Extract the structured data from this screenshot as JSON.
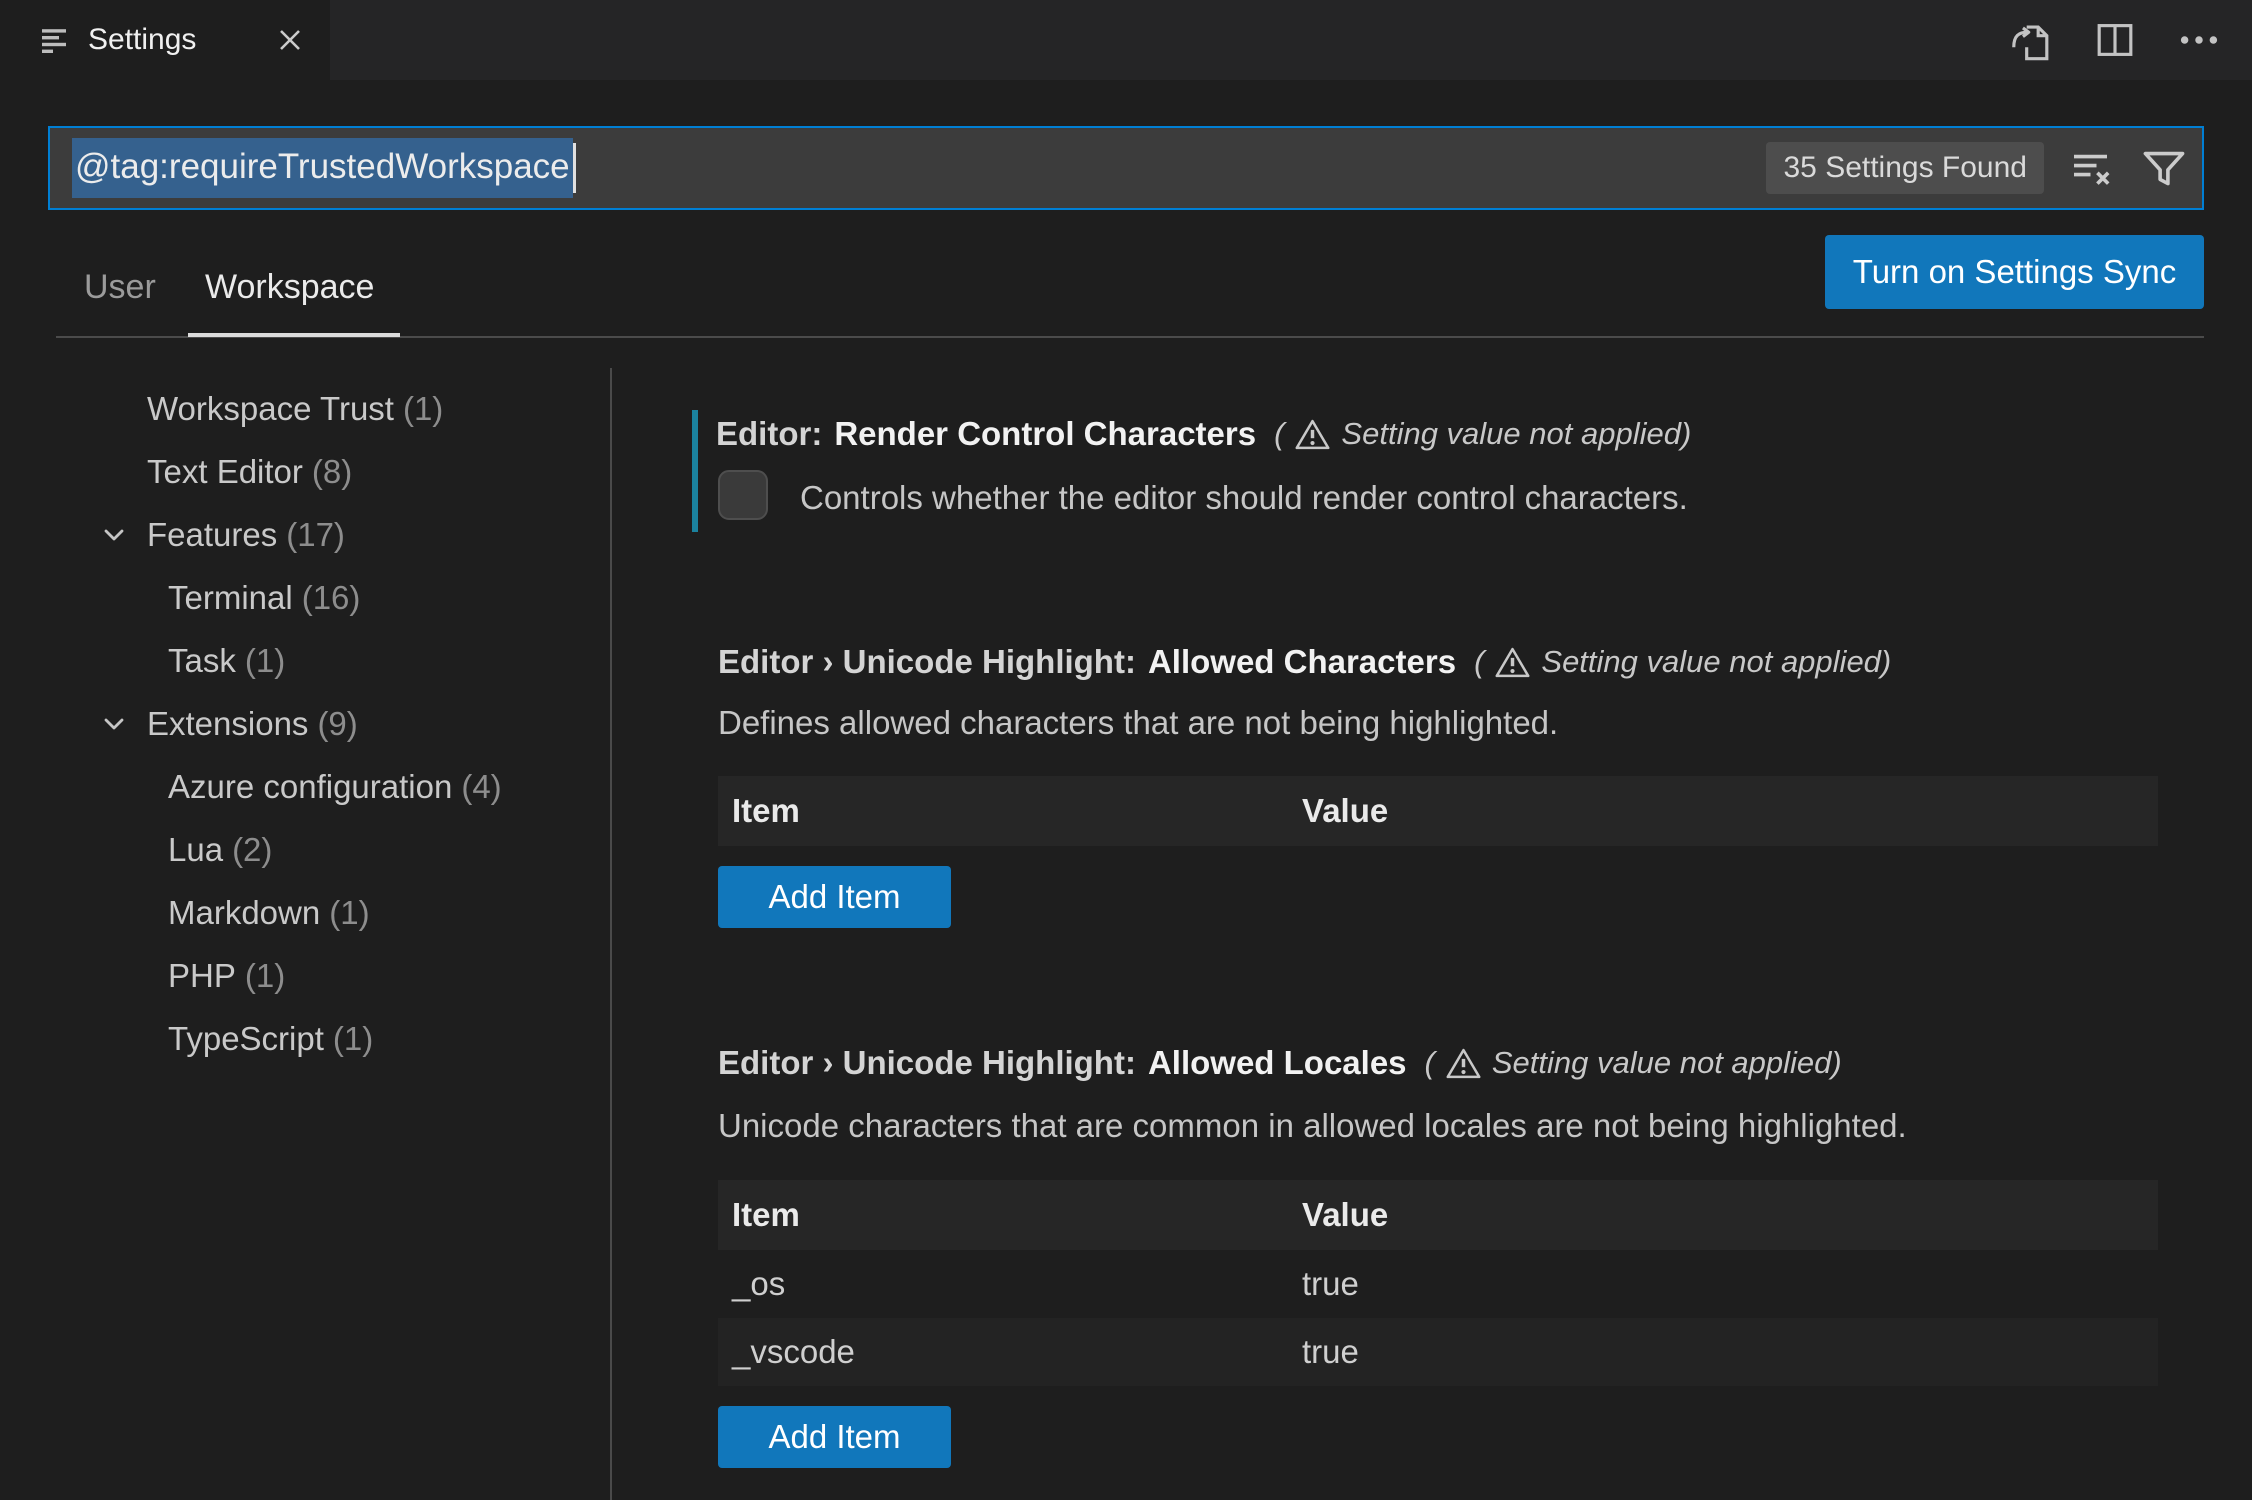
{
  "window": {
    "tab_title": "Settings"
  },
  "editor_actions": {
    "open_settings_json": "open-settings-json",
    "split_editor": "split-editor",
    "more_actions": "more-actions"
  },
  "search": {
    "value": "@tag:requireTrustedWorkspace",
    "results": "35 Settings Found"
  },
  "scope_tabs": {
    "user": "User",
    "workspace": "Workspace"
  },
  "sync_button": {
    "label": "Turn on Settings Sync"
  },
  "toc": [
    {
      "label": "Workspace Trust",
      "count": "(1)"
    },
    {
      "label": "Text Editor",
      "count": "(8)"
    },
    {
      "label": "Features",
      "count": "(17)"
    },
    {
      "label": "Terminal",
      "count": "(16)"
    },
    {
      "label": "Task",
      "count": "(1)"
    },
    {
      "label": "Extensions",
      "count": "(9)"
    },
    {
      "label": "Azure configuration",
      "count": "(4)"
    },
    {
      "label": "Lua",
      "count": "(2)"
    },
    {
      "label": "Markdown",
      "count": "(1)"
    },
    {
      "label": "PHP",
      "count": "(1)"
    },
    {
      "label": "TypeScript",
      "count": "(1)"
    }
  ],
  "settings": [
    {
      "category": "Editor:",
      "name": "Render Control Characters",
      "warn_open": "(",
      "warning": "Setting value not applied)",
      "description": "Controls whether the editor should render control characters.",
      "control": "checkbox",
      "checked": false
    },
    {
      "category": "Editor › Unicode Highlight:",
      "name": "Allowed Characters",
      "warn_open": "(",
      "warning": "Setting value not applied)",
      "description": "Defines allowed characters that are not being highlighted.",
      "table": {
        "headers": [
          "Item",
          "Value"
        ],
        "rows": []
      },
      "add_button": "Add Item"
    },
    {
      "category": "Editor › Unicode Highlight:",
      "name": "Allowed Locales",
      "warn_open": "(",
      "warning": "Setting value not applied)",
      "description": "Unicode characters that are common in allowed locales are not being highlighted.",
      "table": {
        "headers": [
          "Item",
          "Value"
        ],
        "rows": [
          {
            "item": "_os",
            "value": "true"
          },
          {
            "item": "_vscode",
            "value": "true"
          }
        ]
      },
      "add_button": "Add Item"
    }
  ],
  "colors": {
    "accent_blue": "#1177bb",
    "focus_border": "#007fd4",
    "modified_indicator": "#1b829e",
    "selection_background": "#35618e"
  }
}
